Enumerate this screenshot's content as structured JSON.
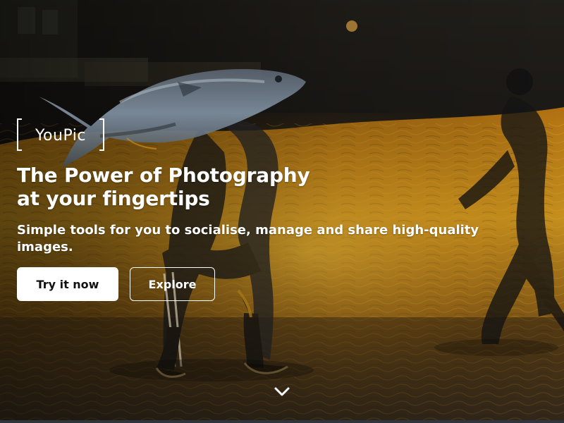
{
  "brand": {
    "name": "YouPic"
  },
  "hero": {
    "headline_line_1": "The Power of Photography",
    "headline_line_2": "at your fingertips",
    "subheadline": "Simple tools for you to socialise, manage and share high-quality images."
  },
  "actions": {
    "primary_label": "Try it now",
    "secondary_label": "Explore"
  },
  "icons": {
    "logo": "brand-logo",
    "scroll": "chevron-down-icon"
  },
  "colors": {
    "text": "#ffffff",
    "button_primary_bg": "#ffffff",
    "button_primary_text": "#111111",
    "water_gold": "#d79a1c",
    "background_dark": "#1b1710"
  }
}
